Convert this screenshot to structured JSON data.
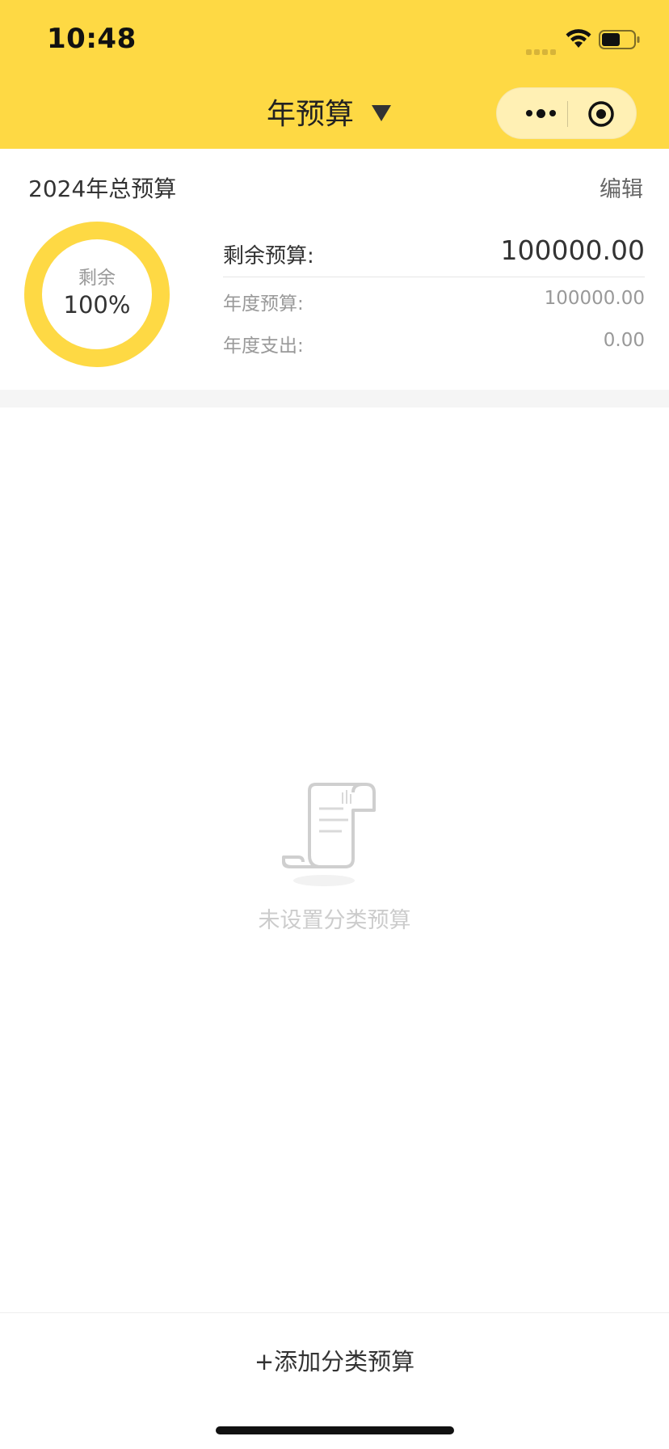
{
  "status_bar": {
    "time": "10:48"
  },
  "nav": {
    "title": "年预算",
    "caret_icon": "caret-down-icon",
    "capsule_icons": [
      "more-dots-icon",
      "target-icon"
    ]
  },
  "summary": {
    "title": "2024年总预算",
    "edit_label": "编辑",
    "ring": {
      "label": "剩余",
      "percent_text": "100%",
      "remaining_fraction": 1.0,
      "color": "#FED944"
    },
    "rows": {
      "remaining": {
        "label": "剩余预算:",
        "value": "100000.00"
      },
      "annual_budget": {
        "label": "年度预算:",
        "value": "100000.00"
      },
      "annual_spend": {
        "label": "年度支出:",
        "value": "0.00"
      }
    }
  },
  "empty_state": {
    "icon": "receipt-scroll-icon",
    "text": "未设置分类预算"
  },
  "bottom": {
    "add_label": "+添加分类预算"
  },
  "colors": {
    "brand_yellow": "#FED944",
    "text_primary": "#333333",
    "text_secondary": "#999999"
  }
}
